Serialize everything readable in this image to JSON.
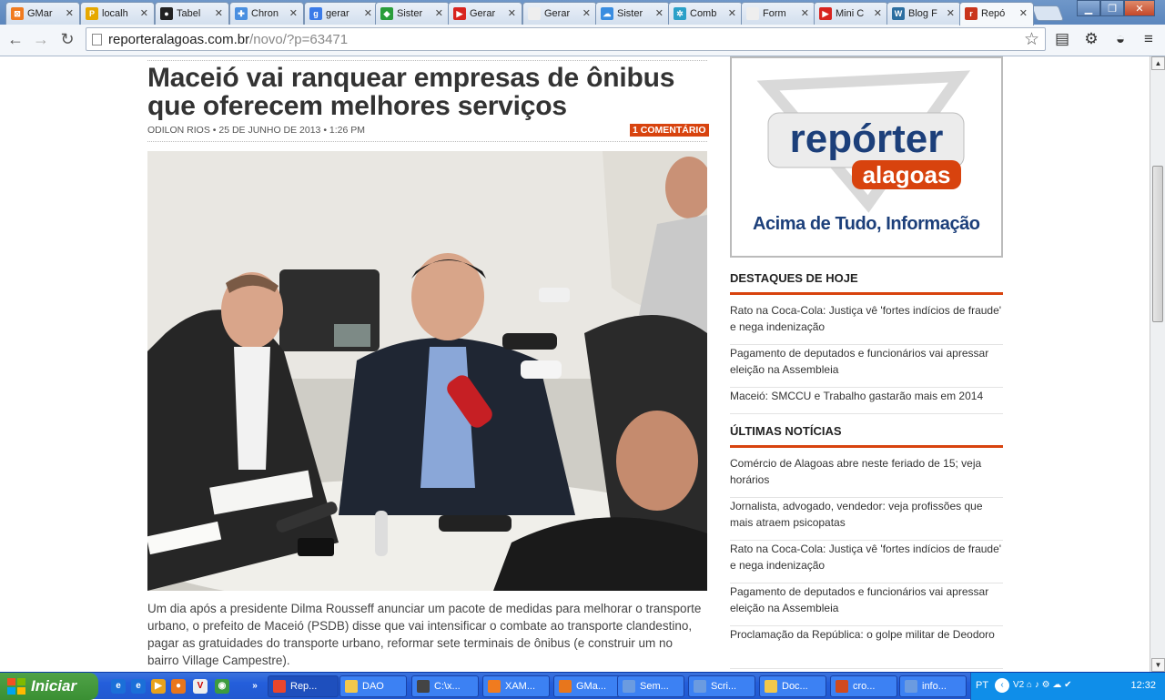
{
  "browser": {
    "tabs": [
      {
        "label": "GMar",
        "icon": "xampp-icon",
        "color": "#f07b1f",
        "glyph": "⊠"
      },
      {
        "label": "localh",
        "icon": "pma-icon",
        "color": "#e6a800",
        "glyph": "P"
      },
      {
        "label": "Tabel",
        "icon": "github-icon",
        "color": "#222",
        "glyph": "●"
      },
      {
        "label": "Chron",
        "icon": "puzzle-icon",
        "color": "#4a8fe0",
        "glyph": "✚"
      },
      {
        "label": "gerar",
        "icon": "google-icon",
        "color": "#3b7be8",
        "glyph": "g"
      },
      {
        "label": "Sister",
        "icon": "brazil-flag-icon",
        "color": "#2a9d3a",
        "glyph": "◆"
      },
      {
        "label": "Gerar",
        "icon": "youtube-icon",
        "color": "#d8241f",
        "glyph": "▶"
      },
      {
        "label": "Gerar",
        "icon": "page-icon",
        "color": "#eee",
        "glyph": ""
      },
      {
        "label": "Sister",
        "icon": "cloud-icon",
        "color": "#3a8de0",
        "glyph": "☁"
      },
      {
        "label": "Comb",
        "icon": "gear-icon",
        "color": "#2aa0c8",
        "glyph": "✲"
      },
      {
        "label": "Form",
        "icon": "page-icon",
        "color": "#eee",
        "glyph": ""
      },
      {
        "label": "Mini C",
        "icon": "youtube-icon",
        "color": "#d8241f",
        "glyph": "▶"
      },
      {
        "label": "Blog F",
        "icon": "wordpress-icon",
        "color": "#2c6ea0",
        "glyph": "W"
      },
      {
        "label": "Repó",
        "icon": "reporter-icon",
        "color": "#c9351c",
        "glyph": "r",
        "active": true
      }
    ],
    "url_host": "reporteralagoas.com.br",
    "url_path": "/novo/?p=63471"
  },
  "article": {
    "headline": "Maceió vai ranquear empresas de ônibus que oferecem melhores serviços",
    "byline": "ODILON RIOS • 25 DE JUNHO DE 2013 • 1:26 PM",
    "comments": "1 COMENTÁRIO",
    "body": "Um dia após a presidente Dilma Rousseff anunciar um pacote de medidas para melhorar o transporte urbano, o prefeito de Maceió (PSDB) disse que vai intensificar o combate ao transporte clandestino, pagar as gratuidades do transporte urbano, reformar sete terminais de ônibus (e construir um no bairro Village Campestre)."
  },
  "sidebar": {
    "logo_top": "repórter",
    "logo_bottom": "alagoas",
    "tagline": "Acima de Tudo, Informação",
    "highlights_title": "DESTAQUES DE HOJE",
    "highlights": [
      "Rato na Coca-Cola: Justiça vê 'fortes indícios de fraude' e nega indenização",
      "Pagamento de deputados e funcionários vai apressar eleição na Assembleia",
      "Maceió: SMCCU e Trabalho gastarão mais em 2014"
    ],
    "latest_title": "ÚLTIMAS NOTÍCIAS",
    "latest": [
      "Comércio de Alagoas abre neste feriado de 15; veja horários",
      "Jornalista, advogado, vendedor: veja profissões que mais atraem psicopatas",
      "Rato na Coca-Cola: Justiça vê 'fortes indícios de fraude' e nega indenização",
      "Pagamento de deputados e funcionários vai apressar eleição na Assembleia",
      "Proclamação da República: o golpe militar de Deodoro"
    ]
  },
  "taskbar": {
    "start_label": "Iniciar",
    "buttons": [
      {
        "label": "Rep...",
        "color": "#e9462c",
        "active": true
      },
      {
        "label": "DAO",
        "color": "#f2c84b"
      },
      {
        "label": "C:\\x...",
        "color": "#444"
      },
      {
        "label": "XAM...",
        "color": "#f07b1f"
      },
      {
        "label": "GMa...",
        "color": "#e8761c"
      },
      {
        "label": "Sem...",
        "color": "#6b9be0"
      },
      {
        "label": "Scri...",
        "color": "#6b9be0"
      },
      {
        "label": "Doc...",
        "color": "#f2c84b"
      },
      {
        "label": "cro...",
        "color": "#d04a1e"
      },
      {
        "label": "info...",
        "color": "#6b9be0"
      }
    ],
    "lang": "PT",
    "clock": "12:32"
  }
}
